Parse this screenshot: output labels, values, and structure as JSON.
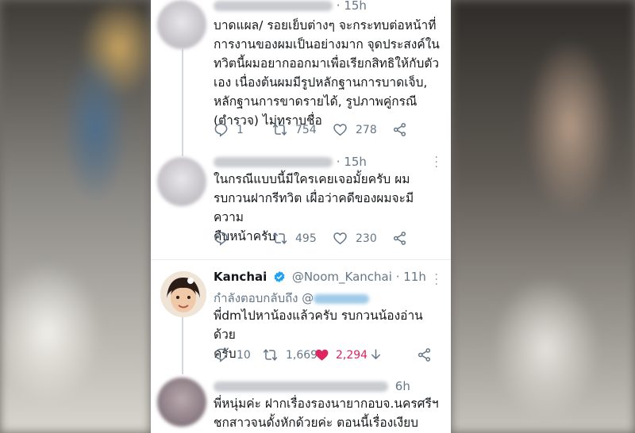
{
  "tweets": [
    {
      "time": "15h",
      "text_lines": [
        "บาดแผล/ รอยเย็บต่างๆ จะกระทบต่อหน้าที่",
        "การงานของผมเป็นอย่างมาก จุดประสงค์ใน",
        "ทวิตนี้ผมอยากออกมาเพื่อเรียกสิทธิให้กับตัว",
        "เอง เนื่องต้นผมมีรูปหลักฐานการบาดเจ็บ,",
        "หลักฐานการขาดรายได้, รูปภาพคู่กรณี",
        "(ตำรวจ) ไม่ทราบชื่อ"
      ],
      "replies": "1",
      "retweets": "754",
      "likes": "278"
    },
    {
      "time": "15h",
      "text_lines": [
        "ในกรณีแบบนี้มีใครเคยเจอมั้ยครับ ผม",
        "รบกวนฝากรีทวิต เผื่อว่าคดีของผมจะมีความ",
        "คืบหน้าครับ"
      ],
      "replies": "",
      "retweets": "495",
      "likes": "230"
    },
    {
      "name": "Kanchai",
      "handle": "@Noom_Kanchai",
      "dot": "·",
      "time": "11h",
      "replying_to": "กำลังตอบกลับถึง @",
      "text_lines": [
        "พี่dmไปหาน้องแล้วครับ รบกวนน้องอ่านด้วย",
        "ครับ"
      ],
      "replies": "10",
      "retweets": "1,669",
      "likes": "2,294",
      "like_color": "#e0245e"
    },
    {
      "time": "6h",
      "text_lines": [
        "พี่หนุ่มค่ะ ฝากเรื่องรองนายากอบจ.นครศรีฯ",
        "ชกสาวจนดั้งหักด้วยค่ะ ตอนนี้เรื่องเงียบ"
      ]
    }
  ],
  "icons": {
    "reply": "reply-icon",
    "retweet": "retweet-icon",
    "like": "heart-icon",
    "share": "share-icon",
    "more": "more-icon",
    "verified": "verified-badge-icon"
  },
  "colors": {
    "link_gray": "#657786",
    "like_red": "#e0245e",
    "verified_blue": "#1da1f2"
  }
}
